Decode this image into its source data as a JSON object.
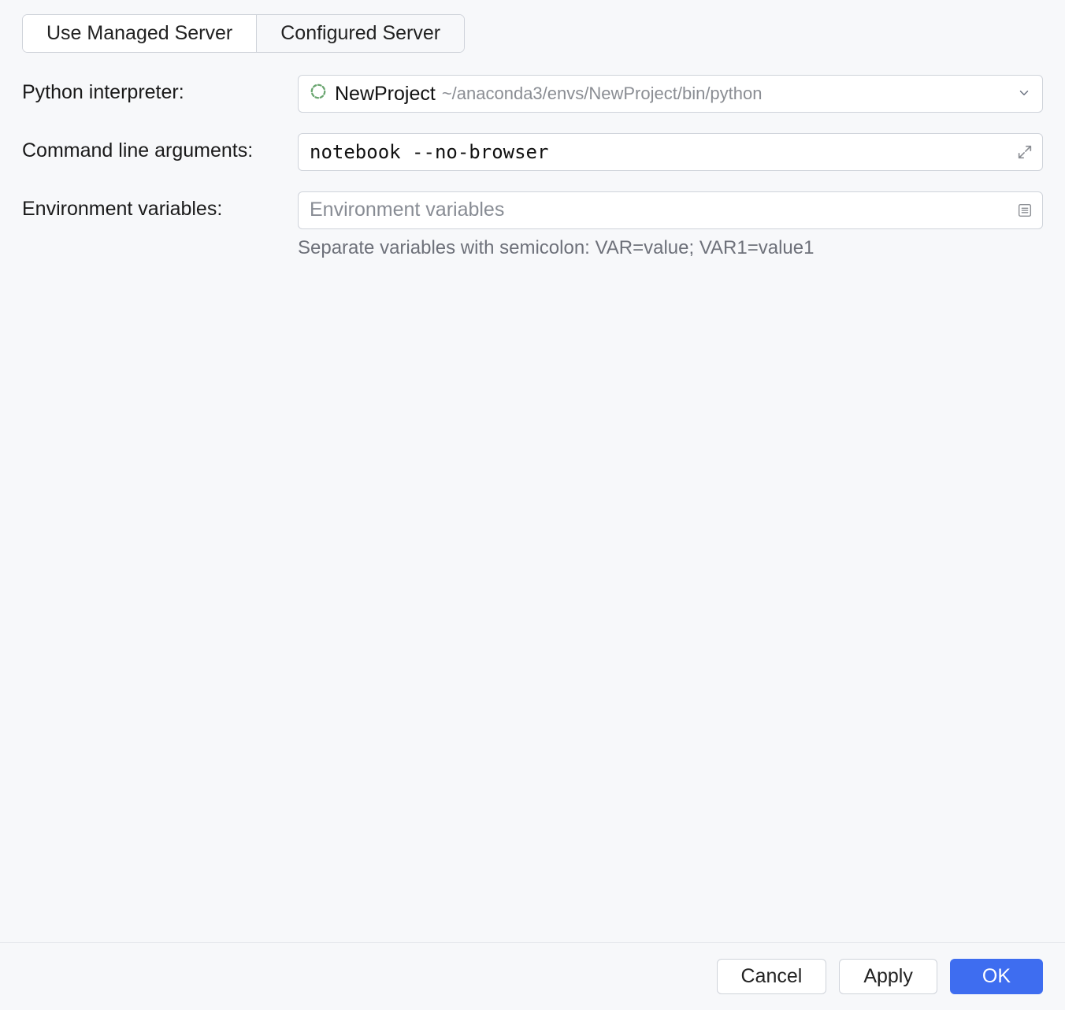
{
  "tabs": {
    "managed": "Use Managed Server",
    "configured": "Configured Server"
  },
  "fields": {
    "interpreter": {
      "label": "Python interpreter:",
      "name": "NewProject",
      "path": "~/anaconda3/envs/NewProject/bin/python"
    },
    "args": {
      "label": "Command line arguments:",
      "value": "notebook --no-browser"
    },
    "env": {
      "label": "Environment variables:",
      "placeholder": "Environment variables",
      "hint": "Separate variables with semicolon: VAR=value; VAR1=value1"
    }
  },
  "footer": {
    "cancel": "Cancel",
    "apply": "Apply",
    "ok": "OK"
  }
}
